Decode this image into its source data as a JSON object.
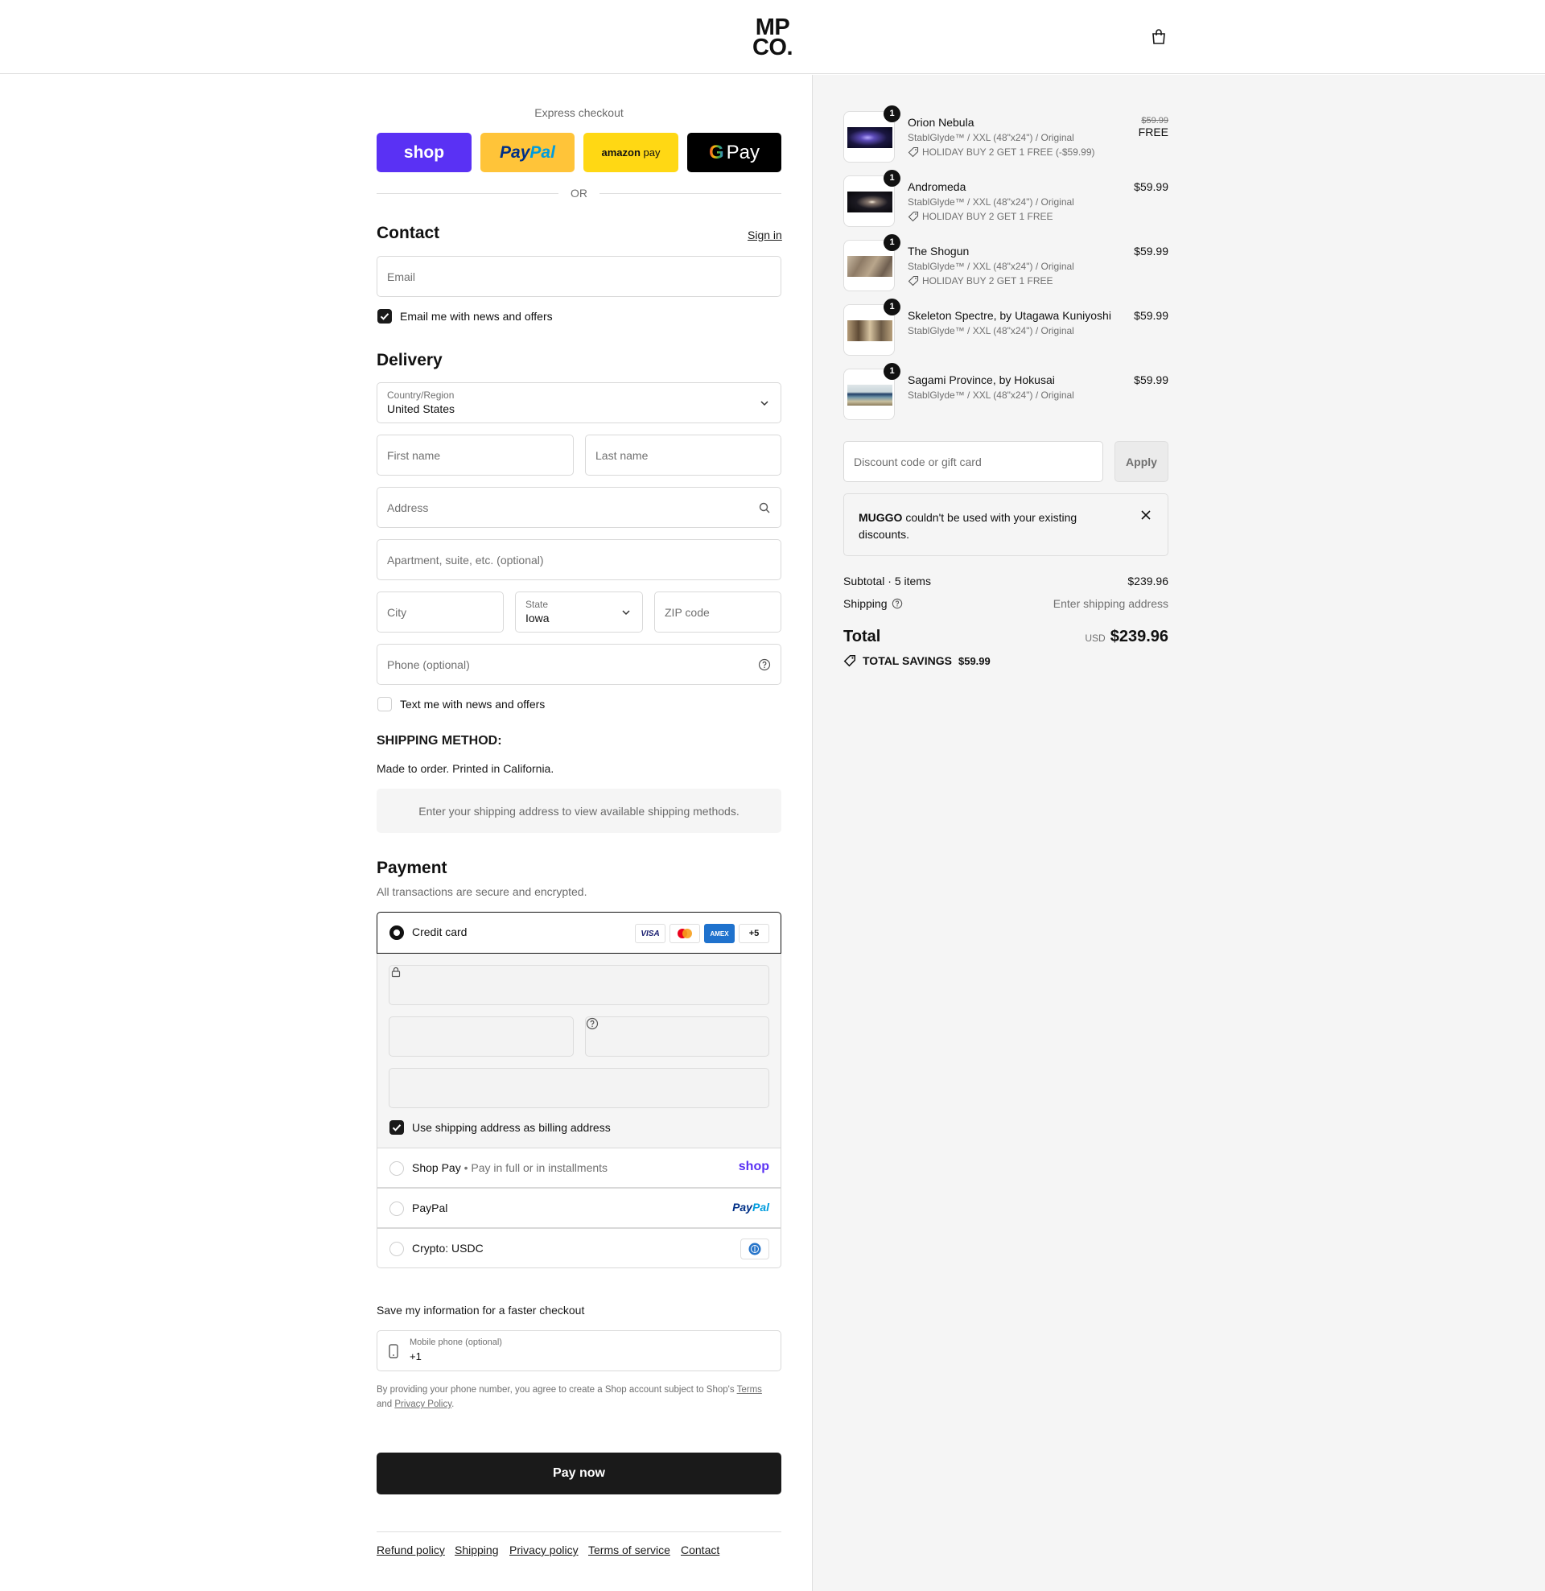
{
  "header": {
    "logo_line1": "MP",
    "logo_line2": "CO.",
    "cart_icon": "shopping-bag-icon"
  },
  "express": {
    "label": "Express checkout",
    "shop_label": "shop",
    "paypal_label_1": "Pay",
    "paypal_label_2": "Pal",
    "amazon_label_1": "amazon",
    "amazon_label_2": " pay",
    "gpay_label": "Pay",
    "or_label": "OR",
    "colors": {
      "shop": "#5a31f4",
      "paypal": "#ffc439",
      "amazon": "#ffd814",
      "gpay": "#000000"
    }
  },
  "contact": {
    "title": "Contact",
    "sign_in": "Sign in",
    "email_placeholder": "Email",
    "news_label": "Email me with news and offers",
    "news_checked": true
  },
  "delivery": {
    "title": "Delivery",
    "country_label": "Country/Region",
    "country_value": "United States",
    "first_name": "First name",
    "last_name": "Last name",
    "address": "Address",
    "apartment": "Apartment, suite, etc. (optional)",
    "city": "City",
    "state_label": "State",
    "state_value": "Iowa",
    "zip": "ZIP code",
    "phone": "Phone (optional)",
    "text_label": "Text me with news and offers",
    "text_checked": false
  },
  "shipping": {
    "title": "SHIPPING METHOD:",
    "note": "Made to order. Printed in California.",
    "placeholder": "Enter your shipping address to view available shipping methods."
  },
  "payment": {
    "title": "Payment",
    "subtitle": "All transactions are secure and encrypted.",
    "credit_card": "Credit card",
    "card_brands": [
      "VISA",
      "mastercard",
      "AMEX",
      "+5"
    ],
    "billing_label": "Use shipping address as billing address",
    "shop_pay": "Shop Pay",
    "shop_pay_sep": "•",
    "shop_pay_note": "Pay in full or in installments",
    "shop_pay_logo": "shop",
    "paypal": "PayPal",
    "paypal_logo_1": "Pay",
    "paypal_logo_2": "Pal",
    "crypto": "Crypto: USDC"
  },
  "save_info": {
    "title": "Save my information for a faster checkout",
    "mobile_label": "Mobile phone (optional)",
    "mobile_value": "+1",
    "legal_1": "By providing your phone number, you agree to create a Shop account subject to Shop's ",
    "legal_terms": "Terms",
    "legal_2": "and ",
    "legal_privacy": "Privacy Policy",
    "legal_3": "."
  },
  "pay_now": "Pay now",
  "footer_links": [
    "Refund policy",
    "Shipping",
    "Privacy policy",
    "Terms of service",
    "Contact"
  ],
  "summary": {
    "items": [
      {
        "qty": "1",
        "name": "Orion Nebula",
        "variant": "StablGlyde™ / XXL (48\"x24\") / Original",
        "discount": "HOLIDAY BUY 2 GET 1 FREE (-$59.99)",
        "price_old": "$59.99",
        "price": "FREE"
      },
      {
        "qty": "1",
        "name": "Andromeda",
        "variant": "StablGlyde™ / XXL (48\"x24\") / Original",
        "discount": "HOLIDAY BUY 2 GET 1 FREE",
        "price": "$59.99"
      },
      {
        "qty": "1",
        "name": "The Shogun",
        "variant": "StablGlyde™ / XXL (48\"x24\") / Original",
        "discount": "HOLIDAY BUY 2 GET 1 FREE",
        "price": "$59.99"
      },
      {
        "qty": "1",
        "name": "Skeleton Spectre, by Utagawa Kuniyoshi",
        "variant": "StablGlyde™ / XXL (48\"x24\") / Original",
        "price": "$59.99"
      },
      {
        "qty": "1",
        "name": "Sagami Province, by Hokusai",
        "variant": "StablGlyde™ / XXL (48\"x24\") / Original",
        "price": "$59.99"
      }
    ],
    "discount_placeholder": "Discount code or gift card",
    "apply": "Apply",
    "alert_code": "MUGGO",
    "alert_text": " couldn't be used with your existing discounts.",
    "subtotal_label": "Subtotal · 5 items",
    "subtotal_value": "$239.96",
    "shipping_label": "Shipping",
    "shipping_value": "Enter shipping address",
    "total_label": "Total",
    "currency": "USD",
    "total_value": "$239.96",
    "savings_label": "TOTAL SAVINGS",
    "savings_value": "$59.99"
  }
}
